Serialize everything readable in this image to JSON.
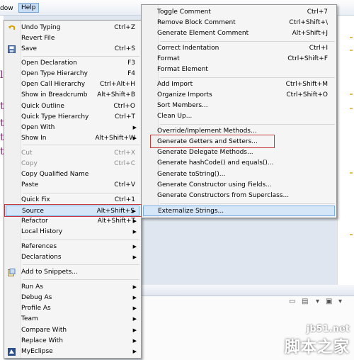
{
  "menubar": {
    "items": [
      "dow",
      "Help"
    ]
  },
  "context_menu": {
    "items": [
      {
        "label": "Undo Typing",
        "shortcut": "Ctrl+Z",
        "icon": "undo-icon"
      },
      {
        "label": "Revert File",
        "shortcut": ""
      },
      {
        "label": "Save",
        "shortcut": "Ctrl+S",
        "icon": "save-icon"
      },
      {
        "label": "Open Declaration",
        "shortcut": "F3"
      },
      {
        "label": "Open Type Hierarchy",
        "shortcut": "F4"
      },
      {
        "label": "Open Call Hierarchy",
        "shortcut": "Ctrl+Alt+H"
      },
      {
        "label": "Show in Breadcrumb",
        "shortcut": "Alt+Shift+B"
      },
      {
        "label": "Quick Outline",
        "shortcut": "Ctrl+O"
      },
      {
        "label": "Quick Type Hierarchy",
        "shortcut": "Ctrl+T"
      },
      {
        "label": "Open With",
        "shortcut": ""
      },
      {
        "label": "Show In",
        "shortcut": "Alt+Shift+W"
      },
      {
        "label": "Cut",
        "shortcut": "Ctrl+X"
      },
      {
        "label": "Copy",
        "shortcut": "Ctrl+C"
      },
      {
        "label": "Copy Qualified Name",
        "shortcut": ""
      },
      {
        "label": "Paste",
        "shortcut": "Ctrl+V"
      },
      {
        "label": "Quick Fix",
        "shortcut": "Ctrl+1"
      },
      {
        "label": "Source",
        "shortcut": "Alt+Shift+S"
      },
      {
        "label": "Refactor",
        "shortcut": "Alt+Shift+T"
      },
      {
        "label": "Local History",
        "shortcut": ""
      },
      {
        "label": "References",
        "shortcut": ""
      },
      {
        "label": "Declarations",
        "shortcut": ""
      },
      {
        "label": "Add to Snippets...",
        "shortcut": "",
        "icon": "snippet-icon"
      },
      {
        "label": "Run As",
        "shortcut": ""
      },
      {
        "label": "Debug As",
        "shortcut": ""
      },
      {
        "label": "Profile As",
        "shortcut": ""
      },
      {
        "label": "Team",
        "shortcut": ""
      },
      {
        "label": "Compare With",
        "shortcut": ""
      },
      {
        "label": "Replace With",
        "shortcut": ""
      },
      {
        "label": "MyEclipse",
        "shortcut": "",
        "icon": "myeclipse-icon"
      }
    ]
  },
  "source_submenu": {
    "items": [
      {
        "label": "Toggle Comment",
        "shortcut": "Ctrl+7"
      },
      {
        "label": "Remove Block Comment",
        "shortcut": "Ctrl+Shift+\\"
      },
      {
        "label": "Generate Element Comment",
        "shortcut": "Alt+Shift+J"
      },
      {
        "label": "Correct Indentation",
        "shortcut": "Ctrl+I"
      },
      {
        "label": "Format",
        "shortcut": "Ctrl+Shift+F"
      },
      {
        "label": "Format Element",
        "shortcut": ""
      },
      {
        "label": "Add Import",
        "shortcut": "Ctrl+Shift+M"
      },
      {
        "label": "Organize Imports",
        "shortcut": "Ctrl+Shift+O"
      },
      {
        "label": "Sort Members...",
        "shortcut": ""
      },
      {
        "label": "Clean Up...",
        "shortcut": ""
      },
      {
        "label": "Override/Implement Methods...",
        "shortcut": ""
      },
      {
        "label": "Generate Getters and Setters...",
        "shortcut": ""
      },
      {
        "label": "Generate Delegate Methods...",
        "shortcut": ""
      },
      {
        "label": "Generate hashCode() and equals()...",
        "shortcut": ""
      },
      {
        "label": "Generate toString()...",
        "shortcut": ""
      },
      {
        "label": "Generate Constructor using Fields...",
        "shortcut": ""
      },
      {
        "label": "Generate Constructors from Superclass...",
        "shortcut": ""
      },
      {
        "label": "Externalize Strings...",
        "shortcut": ""
      }
    ]
  },
  "watermark": {
    "site": "jb51.net",
    "name": "脚本之家"
  },
  "colors": {
    "selection": "#d5e6f8",
    "highlight_border": "#c43a3a"
  }
}
